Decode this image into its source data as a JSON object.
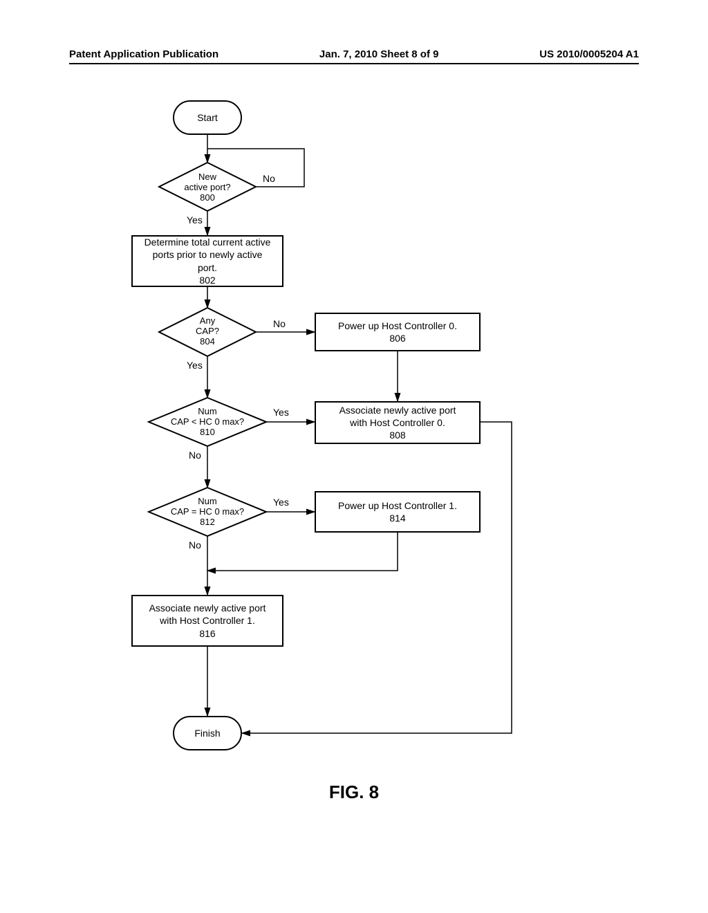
{
  "header": {
    "left": "Patent Application Publication",
    "center": "Jan. 7, 2010  Sheet 8 of 9",
    "right": "US 2010/0005204 A1"
  },
  "nodes": {
    "start": "Start",
    "d800": {
      "l1": "New",
      "l2": "active port?",
      "ref": "800"
    },
    "p802": {
      "l1": "Determine total current active",
      "l2": "ports prior to newly active",
      "l3": "port.",
      "ref": "802"
    },
    "d804": {
      "l1": "Any",
      "l2": "CAP?",
      "ref": "804"
    },
    "p806": {
      "l1": "Power up Host Controller 0.",
      "ref": "806"
    },
    "d810": {
      "l1": "Num",
      "l2": "CAP < HC 0 max?",
      "ref": "810"
    },
    "p808": {
      "l1": "Associate newly active port",
      "l2": "with Host Controller 0.",
      "ref": "808"
    },
    "d812": {
      "l1": "Num",
      "l2": "CAP = HC 0 max?",
      "ref": "812"
    },
    "p814": {
      "l1": "Power up Host Controller 1.",
      "ref": "814"
    },
    "p816": {
      "l1": "Associate newly active port",
      "l2": "with Host Controller 1.",
      "ref": "816"
    },
    "finish": "Finish"
  },
  "labels": {
    "yes": "Yes",
    "no": "No"
  },
  "figure": "FIG. 8"
}
